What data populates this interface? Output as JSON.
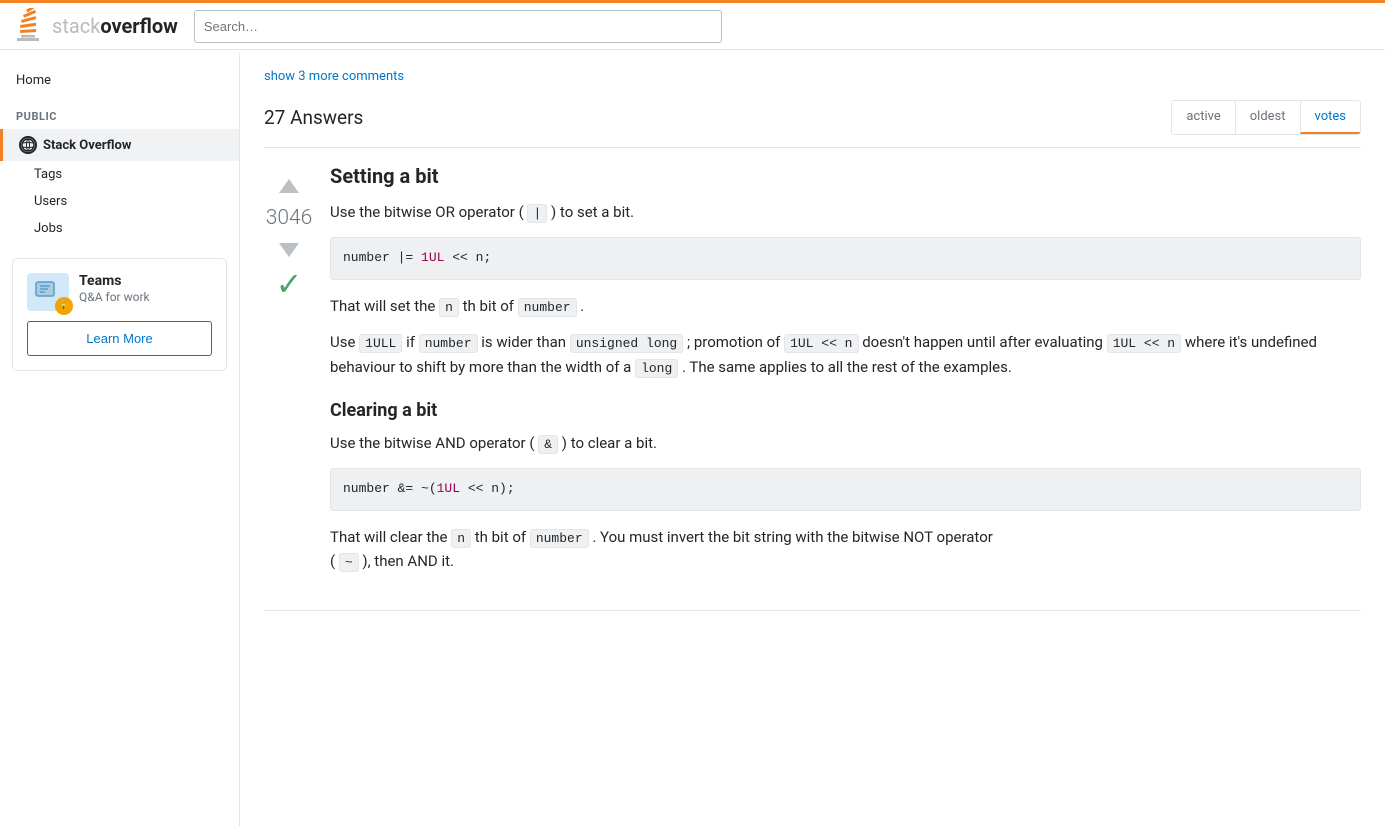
{
  "header": {
    "logo_stack": "stack",
    "logo_overflow": "overflow",
    "search_placeholder": "Search…"
  },
  "sidebar": {
    "home_label": "Home",
    "public_section": "PUBLIC",
    "stack_overflow_label": "Stack Overflow",
    "tags_label": "Tags",
    "users_label": "Users",
    "jobs_label": "Jobs",
    "teams": {
      "title": "Teams",
      "subtitle": "Q&A for work",
      "learn_more": "Learn More"
    }
  },
  "answers": {
    "count_label": "27 Answers",
    "sort": {
      "active_label": "active",
      "oldest_label": "oldest",
      "votes_label": "votes",
      "active_tab": "votes"
    },
    "show_more_comments": "show 3 more comments",
    "items": [
      {
        "vote_count": "3046",
        "accepted": true,
        "title": "Setting a bit",
        "paragraphs": [
          "Use the bitwise OR operator ( | ) to set a bit."
        ],
        "code_block_1": "number |= 1UL << n;",
        "code_block_1_parts": [
          {
            "text": "number ",
            "type": "plain"
          },
          {
            "text": "|=",
            "type": "op"
          },
          {
            "text": " ",
            "type": "plain"
          },
          {
            "text": "1UL",
            "type": "num"
          },
          {
            "text": " << n;",
            "type": "plain"
          }
        ],
        "after_code_1": "That will set the n th bit of number .",
        "para_2_parts": "Use 1ULL if number is wider than unsigned long ; promotion of 1UL << n doesn't happen until after evaluating 1UL << n where it's undefined behaviour to shift by more than the width of a long . The same applies to all the rest of the examples.",
        "subtitle": "Clearing a bit",
        "clear_para": "Use the bitwise AND operator ( & ) to clear a bit.",
        "code_block_2": "number &= ~(1UL << n);",
        "after_code_2_line1": "That will clear the n th bit of number . You must invert the bit string with the bitwise NOT operator",
        "after_code_2_line2": "( ~ ), then AND it."
      }
    ]
  }
}
